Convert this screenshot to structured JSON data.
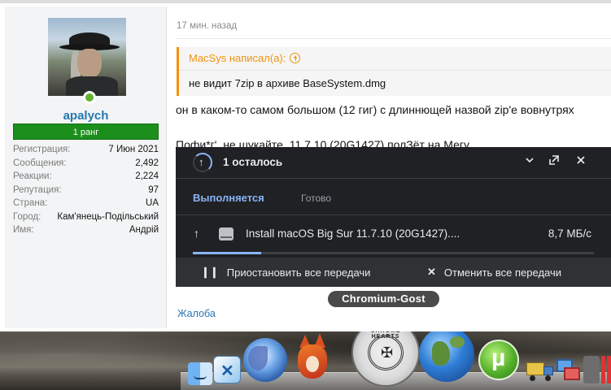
{
  "post": {
    "time": "17 мин. назад",
    "quote_author": "MacSys написал(а):",
    "quote_text": "не видит 7zip в архиве BaseSystem.dmg",
    "text_line1": "он в каком-то самом большом (12 гиг) с длиннющей назвой zip'е вовнутрях",
    "text_line2": "Пофи*г', не шукайте, 11.7.10 (20G1427) полЗёт на Мегу",
    "report_link": "Жалоба"
  },
  "user": {
    "name": "apalych",
    "rank": "1 ранг",
    "stats": [
      {
        "label": "Регистрация:",
        "value": "7 Июн 2021"
      },
      {
        "label": "Сообщения:",
        "value": "2,492"
      },
      {
        "label": "Реакции:",
        "value": "2,224"
      },
      {
        "label": "Репутация:",
        "value": "97"
      },
      {
        "label": "Страна:",
        "value": "UA"
      },
      {
        "label": "Город:",
        "value": "Кам'янець-Подільський"
      },
      {
        "label": "Имя:",
        "value": "Андрій"
      }
    ]
  },
  "downloads": {
    "title": "1 осталось",
    "tab_active": "Выполняется",
    "tab_inactive": "Готово",
    "item": {
      "file_name": "Install macOS Big Sur 11.7.10 (20G1427)....",
      "speed": "8,7 МБ/с",
      "progress": 0.17
    },
    "pause_all": "Приостановить все передачи",
    "cancel_all": "Отменить все передачи"
  },
  "dock": {
    "tooltip": "Chromium-Gost",
    "chrome_hearts_text": "CHROME HEARTS"
  },
  "colors": {
    "link_blue": "#2577b1",
    "quote_orange": "#f2930d",
    "rank_green": "#1c8e1c",
    "panel_bg": "#202124",
    "accent_blue": "#8ab4f8"
  }
}
